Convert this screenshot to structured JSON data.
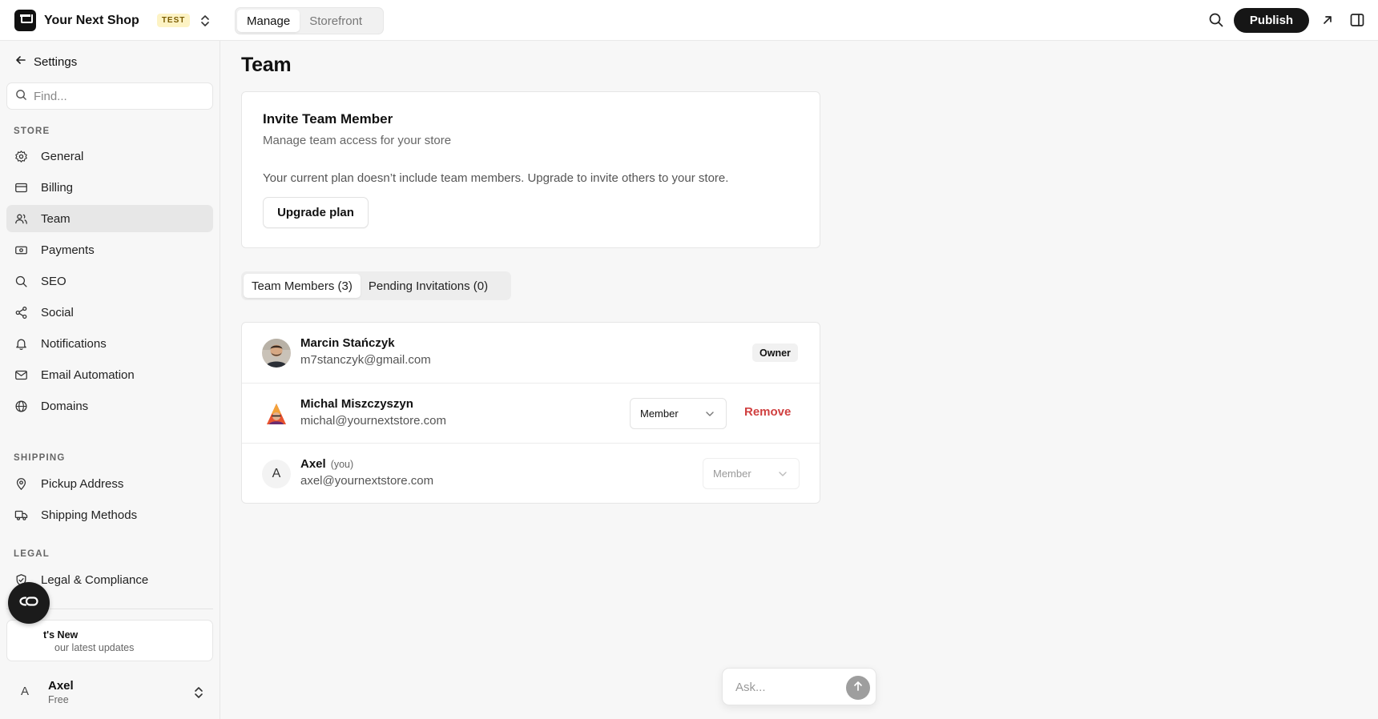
{
  "topbar": {
    "shop_name": "Your Next Shop",
    "env_badge": "TEST",
    "segments": [
      {
        "label": "Manage",
        "active": true
      },
      {
        "label": "Storefront",
        "active": false
      }
    ],
    "publish_label": "Publish"
  },
  "sidebar": {
    "back_label": "Settings",
    "find_placeholder": "Find...",
    "sections": {
      "store": "STORE",
      "shipping": "SHIPPING",
      "legal": "LEGAL"
    },
    "items": [
      {
        "label": "General",
        "icon": "gear-icon"
      },
      {
        "label": "Billing",
        "icon": "card-icon"
      },
      {
        "label": "Team",
        "icon": "users-icon",
        "active": true
      },
      {
        "label": "Payments",
        "icon": "banknote-icon"
      },
      {
        "label": "SEO",
        "icon": "search-icon"
      },
      {
        "label": "Social",
        "icon": "share-icon"
      },
      {
        "label": "Notifications",
        "icon": "bell-icon"
      },
      {
        "label": "Email Automation",
        "icon": "mail-icon"
      },
      {
        "label": "Domains",
        "icon": "globe-icon"
      },
      {
        "label": "Pickup Address",
        "icon": "map-pin-icon"
      },
      {
        "label": "Shipping Methods",
        "icon": "truck-icon"
      },
      {
        "label": "Legal & Compliance",
        "icon": "shield-check-icon"
      }
    ],
    "whats_new": {
      "title": "t's New",
      "subtitle": "our latest updates"
    },
    "user": {
      "avatar_letter": "A",
      "name": "Axel",
      "plan": "Free"
    }
  },
  "main": {
    "title": "Team",
    "invite": {
      "title": "Invite Team Member",
      "subtitle": "Manage team access for your store",
      "message": "Your current plan doesn’t include team members. Upgrade to invite others to your store.",
      "upgrade_label": "Upgrade plan"
    },
    "tabs": [
      {
        "label": "Team Members (3)",
        "active": true
      },
      {
        "label": "Pending Invitations (0)",
        "active": false
      }
    ],
    "members": [
      {
        "name": "Marcin Stańczyk",
        "email": "m7stanczyk@gmail.com",
        "badge": "Owner"
      },
      {
        "name": "Michal Miszczyszyn",
        "email": "michal@yournextstore.com",
        "role": "Member",
        "remove_label": "Remove"
      },
      {
        "name": "Axel",
        "you_label": "(you)",
        "email": "axel@yournextstore.com",
        "role": "Member",
        "avatar_letter": "A"
      }
    ]
  },
  "ask": {
    "placeholder": "Ask..."
  },
  "colors": {
    "accent_dark": "#161616",
    "danger": "#d04040",
    "test_badge_bg": "#fdf3c4"
  }
}
